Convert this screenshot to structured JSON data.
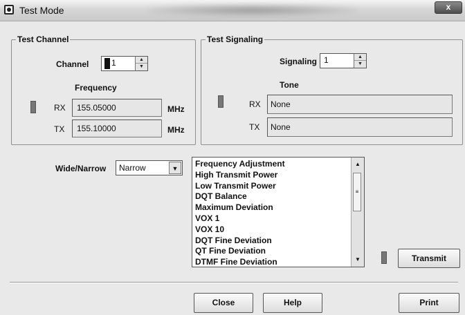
{
  "window": {
    "title": "Test Mode",
    "close_label": "x"
  },
  "test_channel": {
    "legend": "Test Channel",
    "channel_label": "Channel",
    "channel_value": "1",
    "frequency_label": "Frequency",
    "rx_label": "RX",
    "rx_value": "155.05000",
    "tx_label": "TX",
    "tx_value": "155.10000",
    "unit": "MHz"
  },
  "test_signaling": {
    "legend": "Test Signaling",
    "signaling_label": "Signaling",
    "signaling_value": "1",
    "tone_label": "Tone",
    "rx_label": "RX",
    "rx_value": "None",
    "tx_label": "TX",
    "tx_value": "None"
  },
  "wide_narrow": {
    "label": "Wide/Narrow",
    "selected": "Narrow"
  },
  "test_list": {
    "items": [
      "Frequency Adjustment",
      "High Transmit Power",
      "Low Transmit Power",
      "DQT Balance",
      "Maximum Deviation",
      "VOX 1",
      "VOX 10",
      "DQT Fine Deviation",
      "QT Fine Deviation",
      "DTMF Fine Deviation"
    ]
  },
  "buttons": {
    "transmit": "Transmit",
    "close": "Close",
    "help": "Help",
    "print": "Print"
  }
}
